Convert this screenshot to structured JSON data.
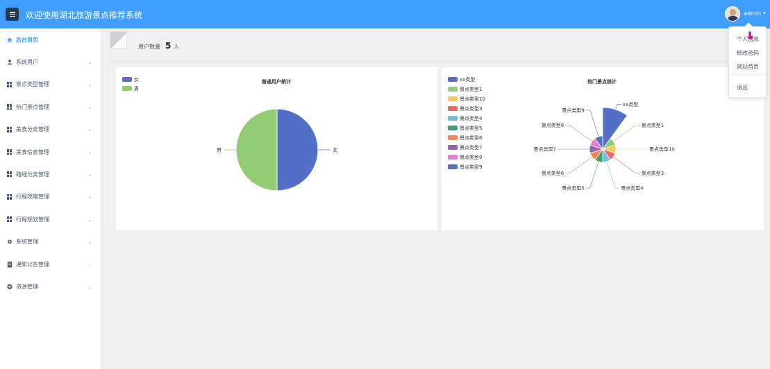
{
  "header": {
    "title": "欢迎使用湖北旅游景点推荐系统",
    "user_name": "admin",
    "user_caret": "▾",
    "menu_icon": "hamburger-icon",
    "brand_color": "#409eff"
  },
  "sidebar": {
    "items": [
      {
        "label": "后台首页",
        "icon": "home-icon",
        "active": true
      },
      {
        "label": "系统用户",
        "icon": "user-icon"
      },
      {
        "label": "景点类型管理",
        "icon": "grid-icon"
      },
      {
        "label": "热门景点管理",
        "icon": "grid-icon"
      },
      {
        "label": "美食分类管理",
        "icon": "grid-icon"
      },
      {
        "label": "美食信息管理",
        "icon": "grid-icon"
      },
      {
        "label": "路线分类管理",
        "icon": "grid-icon"
      },
      {
        "label": "行程攻略管理",
        "icon": "grid-icon"
      },
      {
        "label": "行程规划管理",
        "icon": "grid-icon"
      },
      {
        "label": "系统管理",
        "icon": "gear-icon"
      },
      {
        "label": "通知公告管理",
        "icon": "document-icon"
      },
      {
        "label": "资源管理",
        "icon": "plus-circle-icon"
      }
    ]
  },
  "stats": {
    "label": "用户数量",
    "value": "5",
    "unit": "人"
  },
  "dropdown": {
    "items": [
      "个人信息",
      "修改密码",
      "网站首页",
      "退出"
    ]
  },
  "chart_data": [
    {
      "type": "pie",
      "title": "普通用户统计",
      "legend_position": "top-left",
      "slices": [
        {
          "name": "女",
          "value": 2.5,
          "color": "#5470c6"
        },
        {
          "name": "男",
          "value": 2.5,
          "color": "#91cc75"
        }
      ]
    },
    {
      "type": "pie",
      "title": "热门景点统计",
      "legend_position": "left",
      "rose": true,
      "slices": [
        {
          "name": "xx类型",
          "value": 10,
          "color": "#5470c6"
        },
        {
          "name": "景点类型1",
          "value": 1,
          "color": "#91cc75"
        },
        {
          "name": "景点类型10",
          "value": 1,
          "color": "#fac858"
        },
        {
          "name": "景点类型3",
          "value": 1,
          "color": "#ee6666"
        },
        {
          "name": "景点类型4",
          "value": 1,
          "color": "#73c0de"
        },
        {
          "name": "景点类型5",
          "value": 1,
          "color": "#3ba272"
        },
        {
          "name": "景点类型6",
          "value": 1,
          "color": "#fc8452"
        },
        {
          "name": "景点类型7",
          "value": 1,
          "color": "#9a60b4"
        },
        {
          "name": "景点类型8",
          "value": 1,
          "color": "#ea7ccc"
        },
        {
          "name": "景点类型9",
          "value": 1,
          "color": "#5470c6"
        }
      ]
    }
  ]
}
